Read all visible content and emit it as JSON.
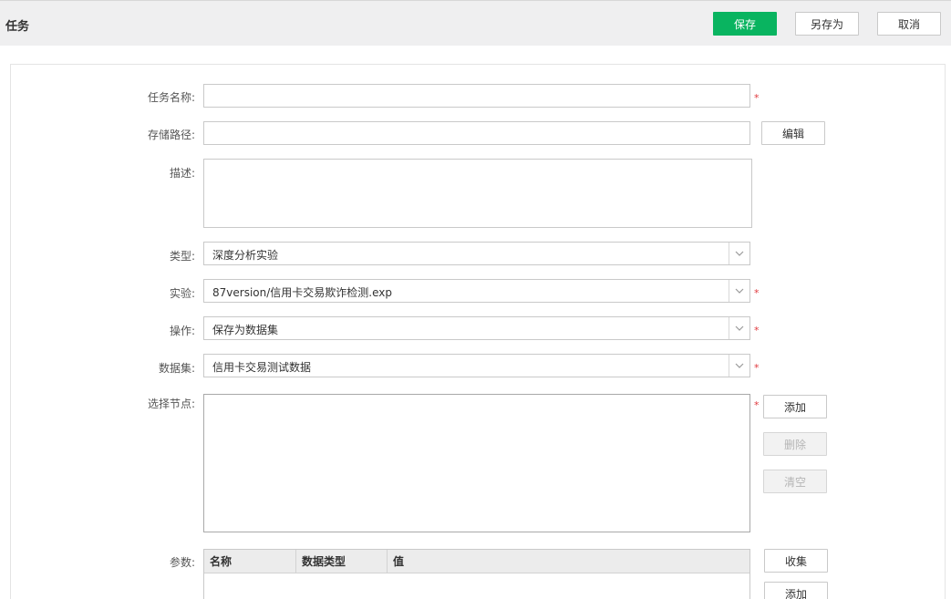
{
  "header": {
    "title": "任务",
    "save_label": "保存",
    "save_as_label": "另存为",
    "cancel_label": "取消"
  },
  "form": {
    "task_name": {
      "label": "任务名称:",
      "value": "",
      "required_mark": "*"
    },
    "storage_path": {
      "label": "存储路径:",
      "value": "",
      "edit_label": "编辑"
    },
    "description": {
      "label": "描述:",
      "value": ""
    },
    "type": {
      "label": "类型:",
      "value": "深度分析实验"
    },
    "experiment": {
      "label": "实验:",
      "value": "87version/信用卡交易欺诈检测.exp",
      "required_mark": "*"
    },
    "operation": {
      "label": "操作:",
      "value": "保存为数据集",
      "required_mark": "*"
    },
    "dataset": {
      "label": "数据集:",
      "value": "信用卡交易测试数据",
      "required_mark": "*"
    },
    "nodes": {
      "label": "选择节点:",
      "required_mark": "*",
      "add_label": "添加",
      "delete_label": "删除",
      "clear_label": "清空"
    },
    "params": {
      "label": "参数:",
      "columns": [
        "名称",
        "数据类型",
        "值"
      ],
      "collect_label": "收集",
      "add_label": "添加"
    }
  },
  "colors": {
    "primary": "#09b460",
    "required": "#e0393e",
    "header_bg": "#efeff0"
  },
  "icons": {
    "dropdown": "chevron-down-icon"
  }
}
